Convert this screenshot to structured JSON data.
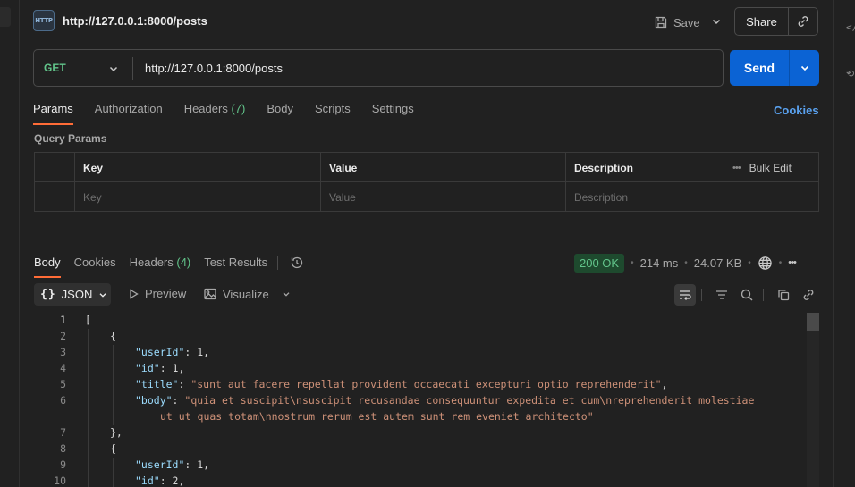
{
  "request": {
    "icon_label": "HTTP",
    "title": "http://127.0.0.1:8000/posts",
    "save_label": "Save",
    "share_label": "Share",
    "method": "GET",
    "url": "http://127.0.0.1:8000/posts",
    "send_label": "Send"
  },
  "request_tabs": [
    {
      "label": "Params",
      "count": ""
    },
    {
      "label": "Authorization",
      "count": ""
    },
    {
      "label": "Headers",
      "count": "(7)"
    },
    {
      "label": "Body",
      "count": ""
    },
    {
      "label": "Scripts",
      "count": ""
    },
    {
      "label": "Settings",
      "count": ""
    }
  ],
  "cookies_label": "Cookies",
  "query_params": {
    "title": "Query Params",
    "columns": [
      "Key",
      "Value",
      "Description"
    ],
    "bulk_edit": "Bulk Edit",
    "placeholders": [
      "Key",
      "Value",
      "Description"
    ]
  },
  "response_tabs": [
    {
      "label": "Body",
      "count": ""
    },
    {
      "label": "Cookies",
      "count": ""
    },
    {
      "label": "Headers",
      "count": "(4)"
    },
    {
      "label": "Test Results",
      "count": ""
    }
  ],
  "status": {
    "code": "200 OK",
    "time": "214 ms",
    "size": "24.07 KB"
  },
  "response_toolbar": {
    "format": "JSON",
    "preview": "Preview",
    "visualize": "Visualize"
  },
  "code_lines": [
    {
      "n": "1",
      "indent": 0,
      "parts": [
        {
          "c": "n",
          "t": "["
        }
      ]
    },
    {
      "n": "2",
      "indent": 1,
      "parts": [
        {
          "c": "n",
          "t": "{"
        }
      ]
    },
    {
      "n": "3",
      "indent": 2,
      "parts": [
        {
          "c": "k",
          "t": "\"userId\""
        },
        {
          "c": "n",
          "t": ": 1,"
        }
      ]
    },
    {
      "n": "4",
      "indent": 2,
      "parts": [
        {
          "c": "k",
          "t": "\"id\""
        },
        {
          "c": "n",
          "t": ": 1,"
        }
      ]
    },
    {
      "n": "5",
      "indent": 2,
      "parts": [
        {
          "c": "k",
          "t": "\"title\""
        },
        {
          "c": "n",
          "t": ": "
        },
        {
          "c": "s",
          "t": "\"sunt aut facere repellat provident occaecati excepturi optio reprehenderit\""
        },
        {
          "c": "n",
          "t": ","
        }
      ]
    },
    {
      "n": "6",
      "indent": 2,
      "parts": [
        {
          "c": "k",
          "t": "\"body\""
        },
        {
          "c": "n",
          "t": ": "
        },
        {
          "c": "s",
          "t": "\"quia et suscipit\\nsuscipit recusandae consequuntur expedita et cum\\nreprehenderit molestiae"
        }
      ]
    },
    {
      "n": "",
      "indent": 3,
      "parts": [
        {
          "c": "s",
          "t": "ut ut quas totam\\nnostrum rerum est autem sunt rem eveniet architecto\""
        }
      ]
    },
    {
      "n": "7",
      "indent": 1,
      "parts": [
        {
          "c": "n",
          "t": "},"
        }
      ]
    },
    {
      "n": "8",
      "indent": 1,
      "parts": [
        {
          "c": "n",
          "t": "{"
        }
      ]
    },
    {
      "n": "9",
      "indent": 2,
      "parts": [
        {
          "c": "k",
          "t": "\"userId\""
        },
        {
          "c": "n",
          "t": ": 1,"
        }
      ]
    },
    {
      "n": "10",
      "indent": 2,
      "parts": [
        {
          "c": "k",
          "t": "\"id\""
        },
        {
          "c": "n",
          "t": ": 2,"
        }
      ]
    }
  ]
}
